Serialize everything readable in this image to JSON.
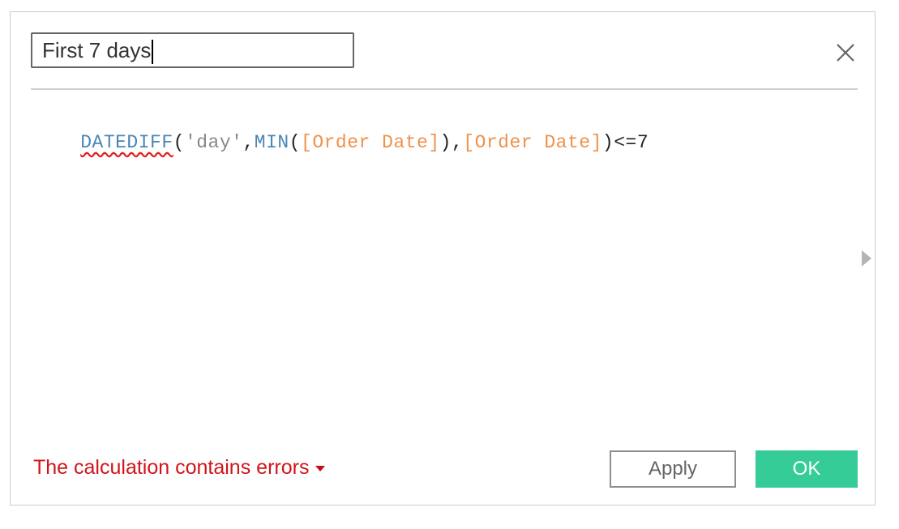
{
  "dialog": {
    "name_value": "First 7 days",
    "close_icon": "close-icon",
    "expand_icon": "triangle-right-icon"
  },
  "formula": {
    "tokens": [
      {
        "text": "DATEDIFF",
        "kind": "function-error"
      },
      {
        "text": "(",
        "kind": "punct"
      },
      {
        "text": "'day'",
        "kind": "string"
      },
      {
        "text": ",",
        "kind": "punct"
      },
      {
        "text": "MIN",
        "kind": "function"
      },
      {
        "text": "(",
        "kind": "punct"
      },
      {
        "text": "[Order Date]",
        "kind": "field"
      },
      {
        "text": "),",
        "kind": "punct"
      },
      {
        "text": "[Order Date]",
        "kind": "field"
      },
      {
        "text": ")<=7",
        "kind": "punct"
      }
    ]
  },
  "status": {
    "error_text": "The calculation contains errors",
    "error_color": "#d1141a"
  },
  "buttons": {
    "apply_label": "Apply",
    "ok_label": "OK",
    "ok_color": "#35cc98"
  }
}
